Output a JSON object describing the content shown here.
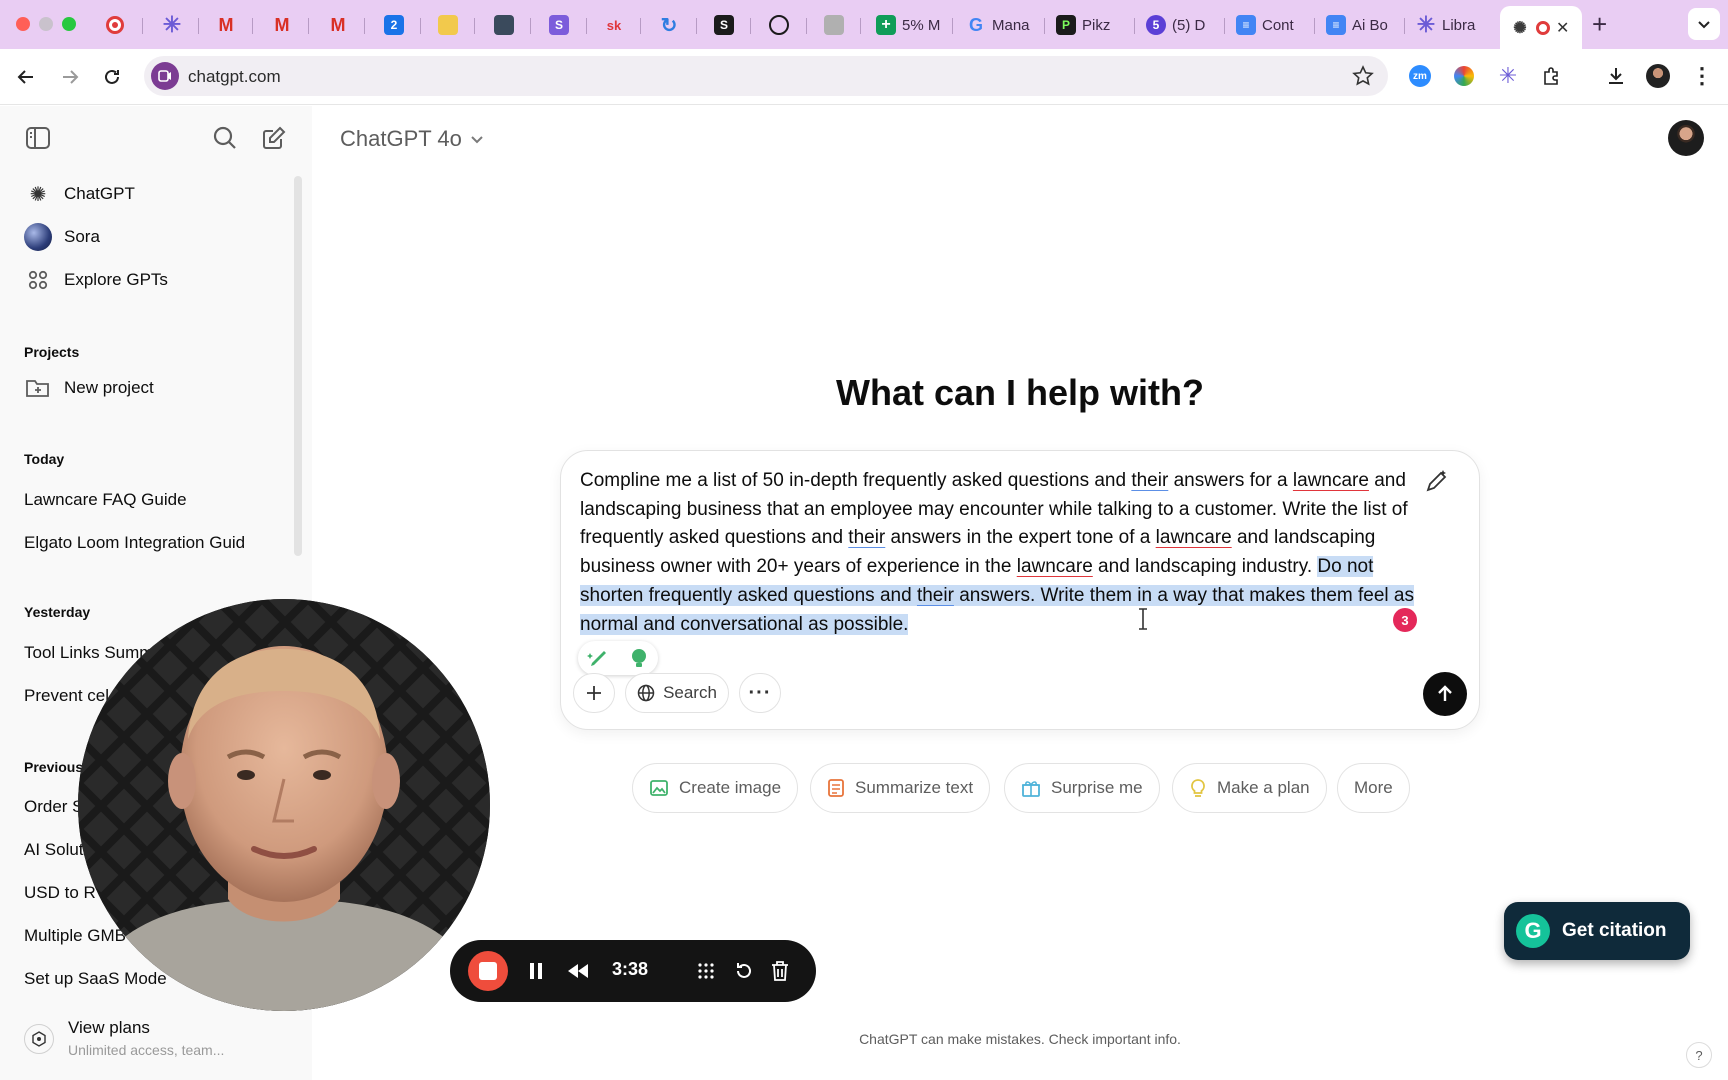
{
  "browser": {
    "tabs": [
      {
        "title": "",
        "favicon": "record-icon",
        "color": "#e03c3c"
      },
      {
        "title": "",
        "favicon": "asterisk-icon",
        "color": "#6b5bd6"
      },
      {
        "title": "",
        "favicon": "gmail-icon",
        "color": "#d93025"
      },
      {
        "title": "",
        "favicon": "gmail-icon",
        "color": "#d93025"
      },
      {
        "title": "",
        "favicon": "gmail-icon",
        "color": "#d93025"
      },
      {
        "title": "",
        "favicon": "calendar-icon",
        "color": "#1a73e8"
      },
      {
        "title": "",
        "favicon": "trello-icon",
        "color": "#f2c94c"
      },
      {
        "title": "",
        "favicon": "doc-icon",
        "color": "#3a4a5c"
      },
      {
        "title": "",
        "favicon": "s-icon",
        "color": "#7c5cdb"
      },
      {
        "title": "",
        "favicon": "sk-icon",
        "color": "#ffffff"
      },
      {
        "title": "",
        "favicon": "sync-icon",
        "color": "#2f7de1"
      },
      {
        "title": "",
        "favicon": "s-square-icon",
        "color": "#1b1b1b"
      },
      {
        "title": "",
        "favicon": "chat-icon",
        "color": "#1b1b1b"
      },
      {
        "title": "",
        "favicon": "book-icon",
        "color": "#8a8a8a"
      },
      {
        "title": "5% M",
        "favicon": "sheets-plus-icon",
        "color": "#0f9d58"
      },
      {
        "title": "Mana",
        "favicon": "google-icon",
        "color": "#4285f4"
      },
      {
        "title": "Pikz",
        "favicon": "pikzels-icon",
        "color": "#1b1b1b"
      },
      {
        "title": "(5) D",
        "favicon": "notification-icon",
        "color": "#d93025"
      },
      {
        "title": "Cont",
        "favicon": "docs-icon",
        "color": "#4285f4"
      },
      {
        "title": "Ai Bo",
        "favicon": "docs-icon",
        "color": "#4285f4"
      },
      {
        "title": "Libra",
        "favicon": "asterisk-icon",
        "color": "#6b5bd6"
      },
      {
        "title": "",
        "favicon": "openai-icon",
        "color": "#3b3b3b",
        "active": true
      }
    ],
    "url": "chatgpt.com"
  },
  "sidebar": {
    "items": [
      {
        "label": "ChatGPT",
        "icon": "openai-icon"
      },
      {
        "label": "Sora",
        "icon": "sora-icon"
      },
      {
        "label": "Explore GPTs",
        "icon": "grid-icon"
      }
    ],
    "projects_heading": "Projects",
    "new_project": "New project",
    "groups": [
      {
        "heading": "Today",
        "chats": [
          "Lawncare FAQ Guide",
          "Elgato Loom Integration Guid"
        ]
      },
      {
        "heading": "Yesterday",
        "chats": [
          "Tool Links Summ",
          "Prevent cel"
        ]
      },
      {
        "heading": "Previous",
        "chats": [
          "Order S",
          "AI Solut",
          "USD to R",
          "Multiple GMB",
          "Set up SaaS Mode"
        ]
      }
    ],
    "plans": {
      "title": "View plans",
      "subtitle": "Unlimited access, team..."
    }
  },
  "main": {
    "model_label": "ChatGPT 4o",
    "heading": "What can I help with?",
    "prompt": {
      "seg1": "Compline me a list of 50 in-depth frequently asked questions and ",
      "their": "their",
      "seg2": " answers for a ",
      "lawncare": "lawncare",
      "seg3": " and landscaping business that an employee may encounter while talking to a customer. Write the list of frequently asked questions and ",
      "seg4": " answers in the expert tone of a ",
      "seg5": " and landscaping business owner with 20+ years of experience in the ",
      "seg6": " and landscaping industry. ",
      "highlighted_a": "Do not shorten frequently asked questions and ",
      "highlighted_b": " answers. Write them in a way that makes them feel as normal and conversational as possible."
    },
    "grammar_badge": "3",
    "search_label": "Search",
    "chips": [
      {
        "label": "Create image",
        "icon": "image-icon",
        "color": "#3fb26b"
      },
      {
        "label": "Summarize text",
        "icon": "doc-text-icon",
        "color": "#e8743b"
      },
      {
        "label": "Surprise me",
        "icon": "gift-icon",
        "color": "#4fb3d9"
      },
      {
        "label": "Make a plan",
        "icon": "lightbulb-icon",
        "color": "#e2c541"
      },
      {
        "label": "More",
        "icon": "",
        "color": ""
      }
    ],
    "footer": "ChatGPT can make mistakes. Check important info.",
    "help": "?"
  },
  "citation": {
    "label": "Get citation",
    "logo": "G"
  },
  "recorder": {
    "time": "3:38"
  }
}
